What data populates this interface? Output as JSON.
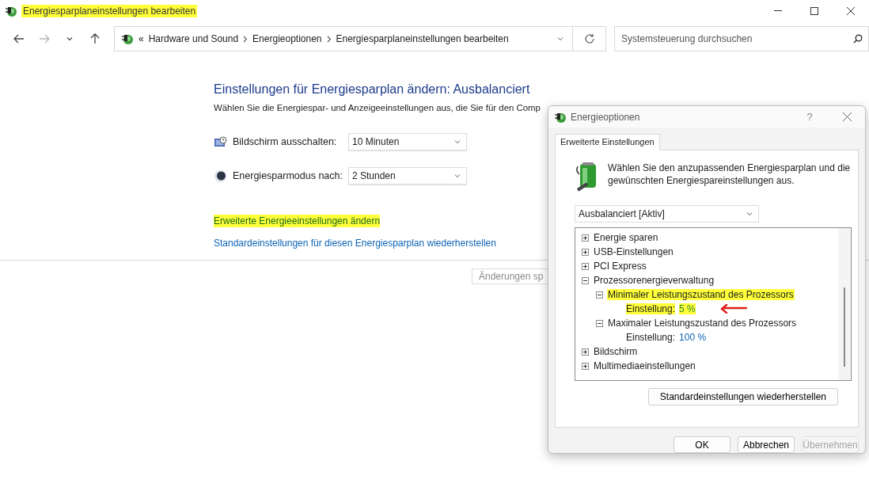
{
  "window": {
    "title": "Energiesparplaneinstellungen bearbeiten",
    "title_highlighted": true
  },
  "nav_buttons": [
    {
      "kind": "back",
      "disabled": false
    },
    {
      "kind": "forward",
      "disabled": true
    },
    {
      "kind": "recent",
      "disabled": false
    },
    {
      "kind": "up",
      "disabled": false
    }
  ],
  "address_bar": {
    "overflow": "«",
    "crumbs": [
      "Hardware und Sound",
      "Energieoptionen",
      "Energiesparplaneinstellungen bearbeiten"
    ]
  },
  "search": {
    "placeholder": "Systemsteuerung durchsuchen"
  },
  "heading": "Einstellungen für Energiesparplan ändern: Ausbalanciert",
  "description": "Wählen Sie die Energiespar- und Anzeigeeinstellungen aus, die Sie für den Comp",
  "settings": [
    {
      "kind": "display",
      "label": "Bildschirm ausschalten:",
      "value": "10 Minuten"
    },
    {
      "kind": "sleep",
      "label": "Energiesparmodus nach:",
      "value": "2 Stunden"
    }
  ],
  "links": [
    {
      "label": "Erweiterte Energieeinstellungen ändern",
      "highlighted": true
    },
    {
      "label": "Standardeinstellungen für diesen Energiesparplan wiederherstellen",
      "highlighted": false
    }
  ],
  "save_button": {
    "label": "Änderungen sp"
  },
  "dialog": {
    "title": "Energieoptionen",
    "help": "?",
    "tabs": [
      {
        "label": "Erweiterte Einstellungen",
        "selected": true
      }
    ],
    "intro": "Wählen Sie den anzupassenden Energiesparplan und die gewünschten Energiespareinstellungen aus.",
    "plan": "Ausbalanciert [Aktiv]",
    "tree": [
      {
        "label": "Energie sparen",
        "expanded": false,
        "highlighted": false
      },
      {
        "label": "USB-Einstellungen",
        "expanded": false,
        "highlighted": false
      },
      {
        "label": "PCI Express",
        "expanded": false,
        "highlighted": false
      },
      {
        "label": "Prozessorenergieverwaltung",
        "expanded": true,
        "highlighted": false,
        "children": [
          {
            "label": "Minimaler Leistungszustand des Prozessors",
            "expanded": true,
            "highlighted": true,
            "children": [
              {
                "kind": "setting",
                "label": "Einstellung:",
                "value": "5 %",
                "highlighted": true,
                "arrow": true
              }
            ]
          },
          {
            "label": "Maximaler Leistungszustand des Prozessors",
            "expanded": true,
            "highlighted": false,
            "children": [
              {
                "kind": "setting",
                "label": "Einstellung:",
                "value": "100 %",
                "highlighted": false,
                "arrow": false
              }
            ]
          }
        ]
      },
      {
        "label": "Bildschirm",
        "expanded": false,
        "highlighted": false
      },
      {
        "label": "Multimediaeinstellungen",
        "expanded": false,
        "highlighted": false
      }
    ],
    "restore_button": "Standardeinstellungen wiederherstellen",
    "buttons": [
      {
        "label": "OK",
        "disabled": false
      },
      {
        "label": "Abbrechen",
        "disabled": false
      },
      {
        "label": "Übernehmen",
        "disabled": true
      }
    ]
  }
}
